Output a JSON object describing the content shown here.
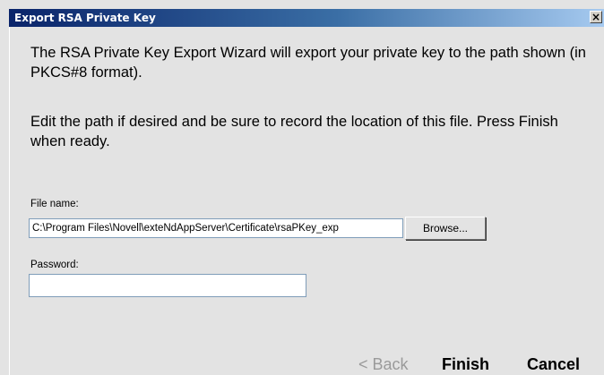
{
  "window": {
    "title": "Export RSA Private Key",
    "close_glyph": "×",
    "close_icon": "close-icon"
  },
  "description": {
    "paragraph1": "The RSA Private Key Export Wizard will export your private key to the path shown (in PKCS#8 format).",
    "paragraph2": "Edit the path if desired and be sure to record the location of this file.  Press Finish when ready."
  },
  "file_name": {
    "label": "File name:",
    "value": "C:\\Program Files\\Novell\\exteNdAppServer\\Certificate\\rsaPKey_exp"
  },
  "browse": {
    "label": "Browse..."
  },
  "password": {
    "label": "Password:",
    "value": ""
  },
  "navigation": {
    "back_label": "< Back",
    "finish_label": "Finish",
    "cancel_label": "Cancel"
  },
  "colors": {
    "title_bar_start": "#0a246a",
    "title_bar_end": "#a6caf0",
    "dialog_background": "#e3e3e3",
    "disabled_text": "#9a9a9a"
  }
}
